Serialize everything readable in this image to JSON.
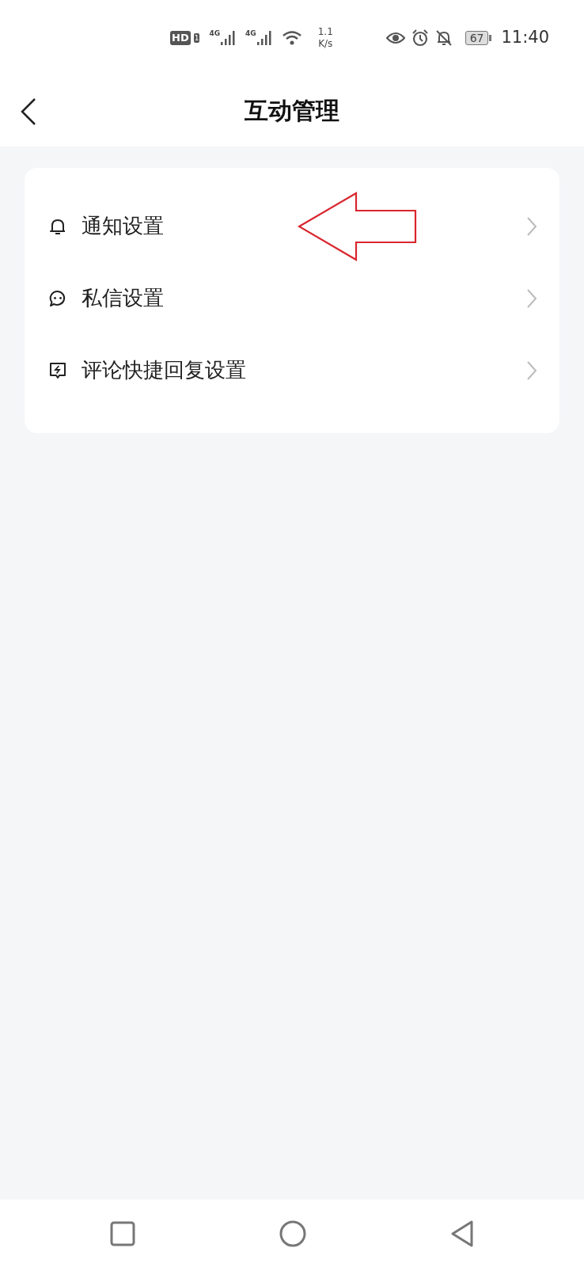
{
  "status_bar": {
    "hd": "HD",
    "sim": "1",
    "networks": [
      "4G",
      "4G"
    ],
    "speed": [
      "1.1",
      "K/s"
    ],
    "battery": "67",
    "time": "11:40"
  },
  "header": {
    "title": "互动管理"
  },
  "menu": [
    {
      "label": "通知设置",
      "kind": "bell"
    },
    {
      "label": "私信设置",
      "kind": "chat"
    },
    {
      "label": "评论快捷回复设置",
      "kind": "bolt"
    }
  ]
}
